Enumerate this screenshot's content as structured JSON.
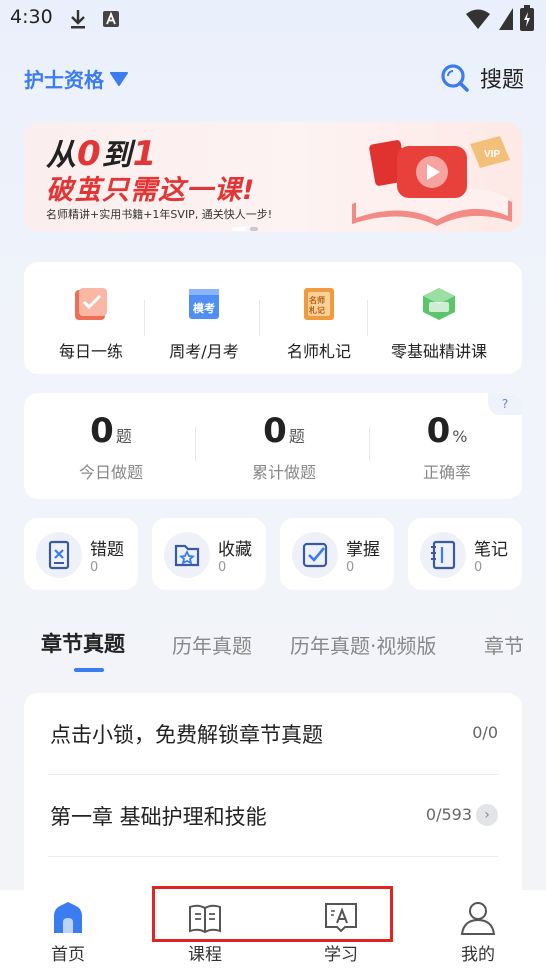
{
  "status_bar": {
    "time": "4:30"
  },
  "header": {
    "exam_name": "护士资格",
    "search_label": "搜题"
  },
  "banner": {
    "line1_prefix": "从",
    "line1_num1": "0",
    "line1_mid": "到",
    "line1_num2": "1",
    "line2": "破茧只需这一课!",
    "line3": "名师精讲+实用书籍+1年SVIP, 通关快人一步!",
    "vip_tag": "VIP"
  },
  "quick_links": [
    {
      "label": "每日一练",
      "icon": "daily-practice-icon"
    },
    {
      "label": "周考/月考",
      "icon": "exam-icon",
      "icon_text": "模考"
    },
    {
      "label": "名师札记",
      "icon": "notes-book-icon",
      "icon_text": "名师札记"
    },
    {
      "label": "零基础精讲课",
      "icon": "basic-course-icon"
    }
  ],
  "stats": {
    "help": "?",
    "today": {
      "value": "0",
      "unit": "题",
      "label": "今日做题"
    },
    "total": {
      "value": "0",
      "unit": "题",
      "label": "累计做题"
    },
    "accuracy": {
      "value": "0",
      "unit": "%",
      "label": "正确率"
    }
  },
  "tools": [
    {
      "label": "错题",
      "count": "0",
      "icon": "wrong-questions-icon"
    },
    {
      "label": "收藏",
      "count": "0",
      "icon": "favorites-icon"
    },
    {
      "label": "掌握",
      "count": "0",
      "icon": "mastered-icon"
    },
    {
      "label": "笔记",
      "count": "0",
      "icon": "notebook-icon"
    }
  ],
  "tabs": [
    {
      "label": "章节真题",
      "active": true
    },
    {
      "label": "历年真题",
      "active": false
    },
    {
      "label": "历年真题·视频版",
      "active": false
    },
    {
      "label": "章节",
      "active": false
    }
  ],
  "chapters": [
    {
      "title": "点击小锁，免费解锁章节真题",
      "count": "0/0"
    },
    {
      "title": "第一章 基础护理和技能",
      "count": "0/593"
    }
  ],
  "bottom_nav": [
    {
      "label": "首页",
      "active": true
    },
    {
      "label": "课程",
      "active": false
    },
    {
      "label": "学习",
      "active": false
    },
    {
      "label": "我的",
      "active": false
    }
  ],
  "colors": {
    "accent": "#3b7cf0",
    "brand_red": "#e23535",
    "highlight": "#e02424"
  }
}
